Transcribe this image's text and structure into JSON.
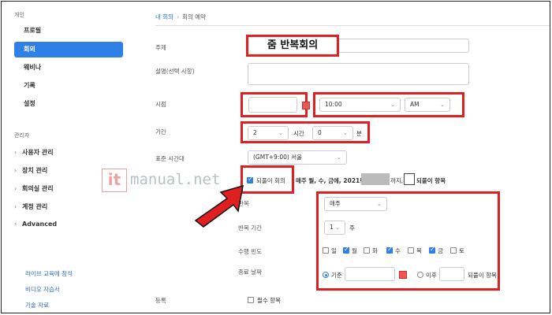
{
  "sidebar": {
    "personal_header": "개인",
    "items": [
      {
        "label": "프로필"
      },
      {
        "label": "회의"
      },
      {
        "label": "웨비나"
      },
      {
        "label": "기록"
      },
      {
        "label": "설정"
      }
    ],
    "admin_header": "관리자",
    "admin_items": [
      {
        "label": "사용자 관리"
      },
      {
        "label": "장치 관리"
      },
      {
        "label": "회의실 관리"
      },
      {
        "label": "계정 관리"
      },
      {
        "label": "Advanced"
      }
    ],
    "links": [
      {
        "label": "라이브 교육에 참석"
      },
      {
        "label": "비디오 자습서"
      },
      {
        "label": "기술 자료"
      }
    ]
  },
  "breadcrumb": {
    "root": "내 회의",
    "sep": "›",
    "current": "회의 예약"
  },
  "overlay_title": "줌 반복회의",
  "form": {
    "topic_label": "주제",
    "description_label": "설명(선택 사항)",
    "when_label": "시점",
    "time_value": "10:00",
    "ampm_value": "AM",
    "duration_label": "기간",
    "duration_hours": "2",
    "hours_unit": "시간",
    "duration_minutes": "0",
    "minutes_unit": "분",
    "timezone_label": "표준 시간대",
    "timezone_value": "(GMT+9:00) 서울",
    "recurring_label": "되풀이 회의",
    "recurring_summary_a": "매주 월, 수, 금에, 2021년",
    "recurring_summary_b": "까지,",
    "recurring_summary_c": "되풀이 항목",
    "repeat_label": "반복",
    "repeat_value": "매주",
    "repeat_interval_label": "반복 기간",
    "repeat_interval_value": "1",
    "repeat_interval_unit": "주",
    "occurs_on_label": "수행 빈도",
    "days": [
      {
        "label": "일",
        "checked": false
      },
      {
        "label": "월",
        "checked": true
      },
      {
        "label": "화",
        "checked": false
      },
      {
        "label": "수",
        "checked": true
      },
      {
        "label": "목",
        "checked": false
      },
      {
        "label": "금",
        "checked": true
      },
      {
        "label": "토",
        "checked": false
      }
    ],
    "end_date_label": "종료 날짜",
    "end_by_label": "기준",
    "end_after_label": "이후",
    "end_after_unit": "되풀이 항목",
    "registration_label": "등록",
    "required_label": "필수 항목"
  },
  "watermark": {
    "logo": "it",
    "text": "manual.net"
  },
  "colors": {
    "accent": "#2f7fe6",
    "highlight": "#e02020",
    "link": "#2f6fd0"
  }
}
